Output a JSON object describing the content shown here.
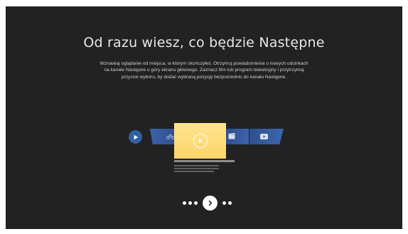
{
  "onboarding": {
    "title": "Od razu wiesz, co będzie Następne",
    "description": "Wznawiaj oglądanie od miejsca, w którym skończyłeś. Otrzymuj powiadomienia o nowych odcinkach na kanale Następne u góry ekranu głównego. Zaznacz film lub program telewizyjny i przytrzymaj przycisk wyboru, by dodać wybraną pozycję bezpośrednio do kanału Następne."
  },
  "illustration": {
    "row_icons": [
      "play-circle-icon",
      "bicycle-icon",
      "play-circle-outline-icon",
      "clapperboard-icon",
      "youtube-icon"
    ],
    "colors": {
      "accent_blue": "#2f61a3",
      "tile_blue": "#375aa0",
      "highlight_yellow": "#fcd46a"
    }
  },
  "pager": {
    "total_pages": 6,
    "current_page": 4,
    "next_icon": "chevron-right-icon"
  },
  "colors": {
    "background": "#222223",
    "text": "#e8e8e8"
  }
}
